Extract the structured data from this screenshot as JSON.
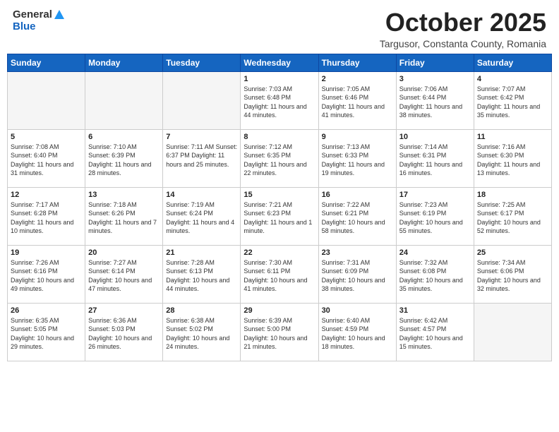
{
  "header": {
    "logo_general": "General",
    "logo_blue": "Blue",
    "month_title": "October 2025",
    "location": "Targusor, Constanta County, Romania"
  },
  "weekdays": [
    "Sunday",
    "Monday",
    "Tuesday",
    "Wednesday",
    "Thursday",
    "Friday",
    "Saturday"
  ],
  "weeks": [
    [
      {
        "day": "",
        "info": ""
      },
      {
        "day": "",
        "info": ""
      },
      {
        "day": "",
        "info": ""
      },
      {
        "day": "1",
        "info": "Sunrise: 7:03 AM\nSunset: 6:48 PM\nDaylight: 11 hours and 44 minutes."
      },
      {
        "day": "2",
        "info": "Sunrise: 7:05 AM\nSunset: 6:46 PM\nDaylight: 11 hours and 41 minutes."
      },
      {
        "day": "3",
        "info": "Sunrise: 7:06 AM\nSunset: 6:44 PM\nDaylight: 11 hours and 38 minutes."
      },
      {
        "day": "4",
        "info": "Sunrise: 7:07 AM\nSunset: 6:42 PM\nDaylight: 11 hours and 35 minutes."
      }
    ],
    [
      {
        "day": "5",
        "info": "Sunrise: 7:08 AM\nSunset: 6:40 PM\nDaylight: 11 hours and 31 minutes."
      },
      {
        "day": "6",
        "info": "Sunrise: 7:10 AM\nSunset: 6:39 PM\nDaylight: 11 hours and 28 minutes."
      },
      {
        "day": "7",
        "info": "Sunrise: 7:11 AM\nSunset: 6:37 PM\nDaylight: 11 hours and 25 minutes."
      },
      {
        "day": "8",
        "info": "Sunrise: 7:12 AM\nSunset: 6:35 PM\nDaylight: 11 hours and 22 minutes."
      },
      {
        "day": "9",
        "info": "Sunrise: 7:13 AM\nSunset: 6:33 PM\nDaylight: 11 hours and 19 minutes."
      },
      {
        "day": "10",
        "info": "Sunrise: 7:14 AM\nSunset: 6:31 PM\nDaylight: 11 hours and 16 minutes."
      },
      {
        "day": "11",
        "info": "Sunrise: 7:16 AM\nSunset: 6:30 PM\nDaylight: 11 hours and 13 minutes."
      }
    ],
    [
      {
        "day": "12",
        "info": "Sunrise: 7:17 AM\nSunset: 6:28 PM\nDaylight: 11 hours and 10 minutes."
      },
      {
        "day": "13",
        "info": "Sunrise: 7:18 AM\nSunset: 6:26 PM\nDaylight: 11 hours and 7 minutes."
      },
      {
        "day": "14",
        "info": "Sunrise: 7:19 AM\nSunset: 6:24 PM\nDaylight: 11 hours and 4 minutes."
      },
      {
        "day": "15",
        "info": "Sunrise: 7:21 AM\nSunset: 6:23 PM\nDaylight: 11 hours and 1 minute."
      },
      {
        "day": "16",
        "info": "Sunrise: 7:22 AM\nSunset: 6:21 PM\nDaylight: 10 hours and 58 minutes."
      },
      {
        "day": "17",
        "info": "Sunrise: 7:23 AM\nSunset: 6:19 PM\nDaylight: 10 hours and 55 minutes."
      },
      {
        "day": "18",
        "info": "Sunrise: 7:25 AM\nSunset: 6:17 PM\nDaylight: 10 hours and 52 minutes."
      }
    ],
    [
      {
        "day": "19",
        "info": "Sunrise: 7:26 AM\nSunset: 6:16 PM\nDaylight: 10 hours and 49 minutes."
      },
      {
        "day": "20",
        "info": "Sunrise: 7:27 AM\nSunset: 6:14 PM\nDaylight: 10 hours and 47 minutes."
      },
      {
        "day": "21",
        "info": "Sunrise: 7:28 AM\nSunset: 6:13 PM\nDaylight: 10 hours and 44 minutes."
      },
      {
        "day": "22",
        "info": "Sunrise: 7:30 AM\nSunset: 6:11 PM\nDaylight: 10 hours and 41 minutes."
      },
      {
        "day": "23",
        "info": "Sunrise: 7:31 AM\nSunset: 6:09 PM\nDaylight: 10 hours and 38 minutes."
      },
      {
        "day": "24",
        "info": "Sunrise: 7:32 AM\nSunset: 6:08 PM\nDaylight: 10 hours and 35 minutes."
      },
      {
        "day": "25",
        "info": "Sunrise: 7:34 AM\nSunset: 6:06 PM\nDaylight: 10 hours and 32 minutes."
      }
    ],
    [
      {
        "day": "26",
        "info": "Sunrise: 6:35 AM\nSunset: 5:05 PM\nDaylight: 10 hours and 29 minutes."
      },
      {
        "day": "27",
        "info": "Sunrise: 6:36 AM\nSunset: 5:03 PM\nDaylight: 10 hours and 26 minutes."
      },
      {
        "day": "28",
        "info": "Sunrise: 6:38 AM\nSunset: 5:02 PM\nDaylight: 10 hours and 24 minutes."
      },
      {
        "day": "29",
        "info": "Sunrise: 6:39 AM\nSunset: 5:00 PM\nDaylight: 10 hours and 21 minutes."
      },
      {
        "day": "30",
        "info": "Sunrise: 6:40 AM\nSunset: 4:59 PM\nDaylight: 10 hours and 18 minutes."
      },
      {
        "day": "31",
        "info": "Sunrise: 6:42 AM\nSunset: 4:57 PM\nDaylight: 10 hours and 15 minutes."
      },
      {
        "day": "",
        "info": ""
      }
    ]
  ]
}
